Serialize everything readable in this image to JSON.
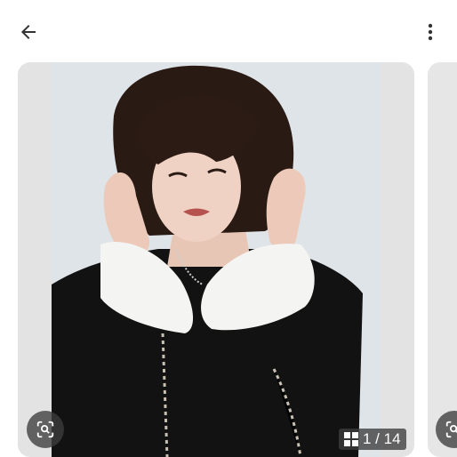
{
  "topbar": {
    "back_icon": "arrow-back-icon",
    "more_icon": "more-vert-icon"
  },
  "carousel": {
    "current_image": {
      "counter_text": "1 / 14",
      "counter_icon": "image-grid-icon",
      "lens_icon": "visual-search-icon"
    },
    "next_image": {
      "lens_icon": "visual-search-icon"
    }
  },
  "colors": {
    "card_background": "#e3e3e3",
    "overlay": "#3c3c3c",
    "icon": "#333333"
  }
}
